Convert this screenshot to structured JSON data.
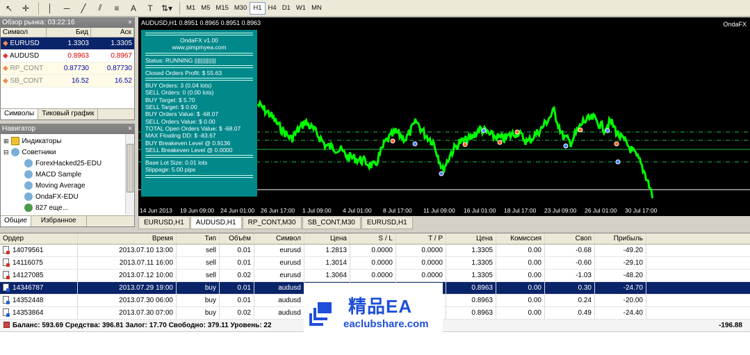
{
  "toolbar": {
    "timeframes": [
      "M1",
      "M5",
      "M15",
      "M30",
      "H1",
      "H4",
      "D1",
      "W1",
      "MN"
    ],
    "active_timeframe": "H1"
  },
  "market_watch": {
    "title": "Обзор рынка: 03:22:16",
    "headers": [
      "Символ",
      "Бид",
      "Аск"
    ],
    "rows": [
      {
        "symbol": "EURUSD",
        "bid": "1.3303",
        "ask": "1.3305"
      },
      {
        "symbol": "AUDUSD",
        "bid": "0.8963",
        "ask": "0.8967"
      },
      {
        "symbol": "RP_CONT",
        "bid": "0.87730",
        "ask": "0.87730"
      },
      {
        "symbol": "SB_CONT",
        "bid": "16.52",
        "ask": "16.52"
      }
    ],
    "tabs": [
      "Символы",
      "Тиковый график"
    ]
  },
  "navigator": {
    "title": "Навигатор",
    "items": [
      "Индикаторы",
      "Советники",
      "ForexHacked25-EDU",
      "MACD Sample",
      "Moving Average",
      "OndaFX-EDU",
      "827 еще..."
    ],
    "tabs": [
      "Общие",
      "Избранное"
    ]
  },
  "chart": {
    "header": "AUDUSD,H1  0.8951 0.8965 0.8951 0.8963",
    "corner_label": "OndaFX",
    "x_labels": [
      "14 Jun 2013",
      "19 Jun 09:00",
      "24 Jun 01:00",
      "26 Jun 17:00",
      "1 Jul 09:00",
      "4 Jul 01:00",
      "8 Jul 17:00",
      "11 Jul 09:00",
      "16 Jul 01:00",
      "18 Jul 17:00",
      "23 Jul 09:00",
      "26 Jul 01:00",
      "30 Jul 17:00"
    ]
  },
  "ea_panel": {
    "name": "OndaFX v1.00",
    "site": "www.pimpmyea.com",
    "status": "Status: RUNNING ||||||||||||||",
    "closed_profit": "Closed Orders Profit: $ 55.63",
    "lines": [
      "BUY Orders: 3 (0.04 lots)",
      "SELL Orders: 0 (0.00 lots)",
      "BUY Target: $ 5.70",
      "SELL Target: $ 0.00",
      "BUY Orders Value: $ -68.07",
      "SELL Orders Value: $ 0.00",
      "TOTAL Open Orders Value: $ -68.07",
      "MAX Floating DD: $ -83.67",
      "BUY Breakeven Level @ 0.9136",
      "SELL Breakeven Level @ 0.0000"
    ],
    "lot_size": "Base Lot Size: 0.01 lots",
    "slippage": "Slippage: 5.00 pips"
  },
  "chart_tabs": [
    "EURUSD,H1",
    "AUDUSD,H1",
    "RP_CONT,M30",
    "SB_CONT,M30",
    "EURUSD,H1"
  ],
  "active_chart_tab": "AUDUSD,H1",
  "terminal": {
    "headers": [
      "Ордер",
      "Время",
      "Тип",
      "Объём",
      "Символ",
      "Цена",
      "S / L",
      "T / P",
      "Цена",
      "Комиссия",
      "Своп",
      "Прибыль"
    ],
    "rows": [
      [
        "14079561",
        "2013.07.10 13:00",
        "sell",
        "0.01",
        "eurusd",
        "1.2813",
        "0.0000",
        "0.0000",
        "1.3305",
        "0.00",
        "-0.68",
        "-49.20"
      ],
      [
        "14116075",
        "2013.07.11 16:00",
        "sell",
        "0.01",
        "eurusd",
        "1.3014",
        "0.0000",
        "0.0000",
        "1.3305",
        "0.00",
        "-0.60",
        "-29.10"
      ],
      [
        "14127085",
        "2013.07.12 10:00",
        "sell",
        "0.02",
        "eurusd",
        "1.3064",
        "0.0000",
        "0.0000",
        "1.3305",
        "0.00",
        "-1.03",
        "-48.20"
      ],
      [
        "14346787",
        "2013.07.29 19:00",
        "buy",
        "0.01",
        "audusd",
        "",
        "",
        "",
        "0.8963",
        "0.00",
        "0.30",
        "-24.70"
      ],
      [
        "14352448",
        "2013.07.30 06:00",
        "buy",
        "0.01",
        "audusd",
        "",
        "",
        "",
        "0.8963",
        "0.00",
        "0.24",
        "-20.00"
      ],
      [
        "14353864",
        "2013.07.30 07:00",
        "buy",
        "0.02",
        "audusd",
        "",
        "",
        "",
        "0.8963",
        "0.00",
        "0.49",
        "-24.40"
      ]
    ],
    "selected_row": 3,
    "balance_text": "Баланс: 593.69  Средства: 396.81  Залог: 17.70  Свободно: 379.11  Уровень: 22",
    "total_profit": "-196.88"
  },
  "watermark": {
    "cn_text": "精品EA",
    "url": "eaclubshare.com"
  },
  "colors": {
    "ea_panel_bg": "#00888a",
    "price_line": "#00ff00",
    "selection": "#0a246a",
    "watermark_blue": "#1e4fd8"
  }
}
